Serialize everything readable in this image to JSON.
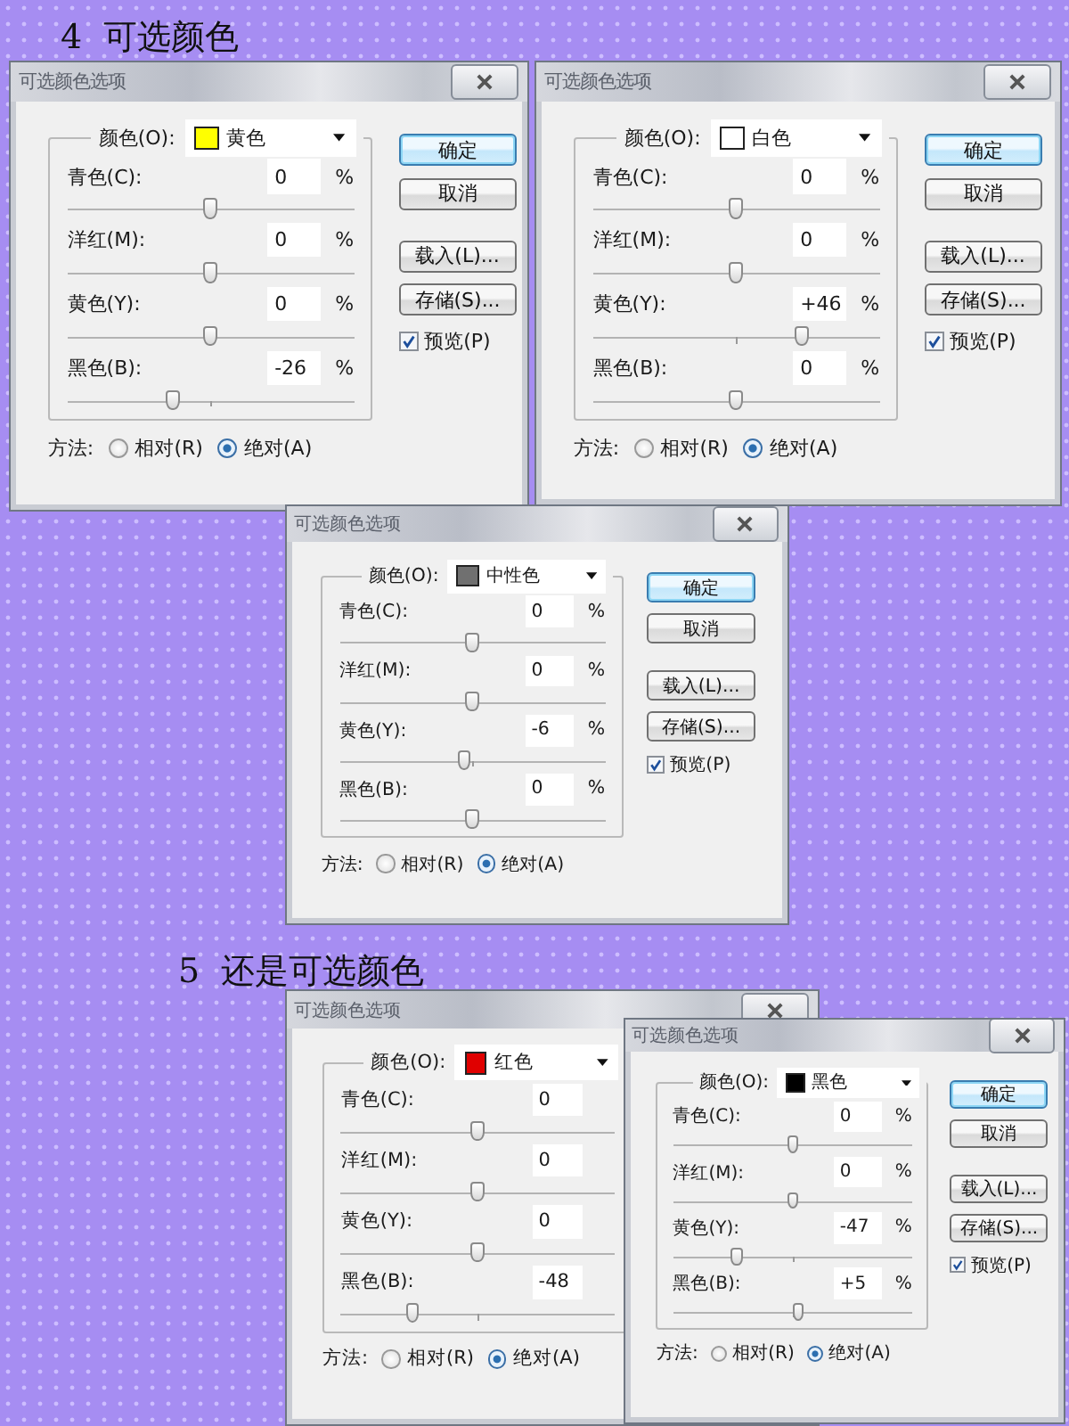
{
  "headings": [
    {
      "text": "4 可选颜色"
    },
    {
      "text": "5 还是可选颜色"
    }
  ],
  "dialogs": [
    {
      "title": "可选颜色选项",
      "color_label": "颜色(O):",
      "color_name": "黄色",
      "color": "#ffff00",
      "rows": [
        {
          "label": "青色(C):",
          "value": "0",
          "unit": "%",
          "level": 0.5
        },
        {
          "label": "洋红(M):",
          "value": "0",
          "unit": "%",
          "level": 0.5
        },
        {
          "label": "黄色(Y):",
          "value": "0",
          "unit": "%",
          "level": 0.5
        },
        {
          "label": "黑色(B):",
          "value": "-26",
          "unit": "%",
          "level": 0.37
        }
      ],
      "buttons": [
        {
          "label": "确定",
          "default": true
        },
        {
          "label": "取消",
          "default": false
        },
        {
          "label": "载入(L)...",
          "default": false
        },
        {
          "label": "存储(S)...",
          "default": false
        }
      ],
      "preview": {
        "label": "预览(P)",
        "checked": true
      },
      "method": {
        "label": "方法:",
        "options": [
          {
            "label": "相对(R)",
            "selected": false
          },
          {
            "label": "绝对(A)",
            "selected": true
          }
        ]
      }
    },
    {
      "title": "可选颜色选项",
      "color_label": "颜色(O):",
      "color_name": "白色",
      "color": "#ffffff",
      "rows": [
        {
          "label": "青色(C):",
          "value": "0",
          "unit": "%",
          "level": 0.5
        },
        {
          "label": "洋红(M):",
          "value": "0",
          "unit": "%",
          "level": 0.5
        },
        {
          "label": "黄色(Y):",
          "value": "+46",
          "unit": "%",
          "level": 0.73
        },
        {
          "label": "黑色(B):",
          "value": "0",
          "unit": "%",
          "level": 0.5
        }
      ],
      "buttons": [
        {
          "label": "确定",
          "default": true
        },
        {
          "label": "取消",
          "default": false
        },
        {
          "label": "载入(L)...",
          "default": false
        },
        {
          "label": "存储(S)...",
          "default": false
        }
      ],
      "preview": {
        "label": "预览(P)",
        "checked": true
      },
      "method": {
        "label": "方法:",
        "options": [
          {
            "label": "相对(R)",
            "selected": false
          },
          {
            "label": "绝对(A)",
            "selected": true
          }
        ]
      }
    },
    {
      "title": "可选颜色选项",
      "color_label": "颜色(O):",
      "color_name": "中性色",
      "color": "#707070",
      "rows": [
        {
          "label": "青色(C):",
          "value": "0",
          "unit": "%",
          "level": 0.5
        },
        {
          "label": "洋红(M):",
          "value": "0",
          "unit": "%",
          "level": 0.5
        },
        {
          "label": "黄色(Y):",
          "value": "-6",
          "unit": "%",
          "level": 0.47
        },
        {
          "label": "黑色(B):",
          "value": "0",
          "unit": "%",
          "level": 0.5
        }
      ],
      "buttons": [
        {
          "label": "确定",
          "default": true
        },
        {
          "label": "取消",
          "default": false
        },
        {
          "label": "载入(L)...",
          "default": false
        },
        {
          "label": "存储(S)...",
          "default": false
        }
      ],
      "preview": {
        "label": "预览(P)",
        "checked": true
      },
      "method": {
        "label": "方法:",
        "options": [
          {
            "label": "相对(R)",
            "selected": false
          },
          {
            "label": "绝对(A)",
            "selected": true
          }
        ]
      }
    },
    {
      "title": "可选颜色选项",
      "color_label": "颜色(O):",
      "color_name": "红色",
      "color": "#e00000",
      "rows": [
        {
          "label": "青色(C):",
          "value": "0",
          "level": 0.5
        },
        {
          "label": "洋红(M):",
          "value": "0",
          "level": 0.5
        },
        {
          "label": "黄色(Y):",
          "value": "0",
          "level": 0.5
        },
        {
          "label": "黑色(B):",
          "value": "-48",
          "level": 0.26
        }
      ],
      "method": {
        "label": "方法:",
        "options": [
          {
            "label": "相对(R)",
            "selected": false
          },
          {
            "label": "绝对(A)",
            "selected": true
          }
        ]
      }
    },
    {
      "title": "可选颜色选项",
      "color_label": "颜色(O):",
      "color_name": "黑色",
      "color": "#000000",
      "rows": [
        {
          "label": "青色(C):",
          "value": "0",
          "unit": "%",
          "level": 0.5
        },
        {
          "label": "洋红(M):",
          "value": "0",
          "unit": "%",
          "level": 0.5
        },
        {
          "label": "黄色(Y):",
          "value": "-47",
          "unit": "%",
          "level": 0.265
        },
        {
          "label": "黑色(B):",
          "value": "+5",
          "unit": "%",
          "level": 0.525
        }
      ],
      "buttons": [
        {
          "label": "确定",
          "default": true
        },
        {
          "label": "取消",
          "default": false
        },
        {
          "label": "载入(L)...",
          "default": false
        },
        {
          "label": "存储(S)...",
          "default": false
        }
      ],
      "preview": {
        "label": "预览(P)",
        "checked": true
      },
      "method": {
        "label": "方法:",
        "options": [
          {
            "label": "相对(R)",
            "selected": false
          },
          {
            "label": "绝对(A)",
            "selected": true
          }
        ]
      }
    }
  ]
}
